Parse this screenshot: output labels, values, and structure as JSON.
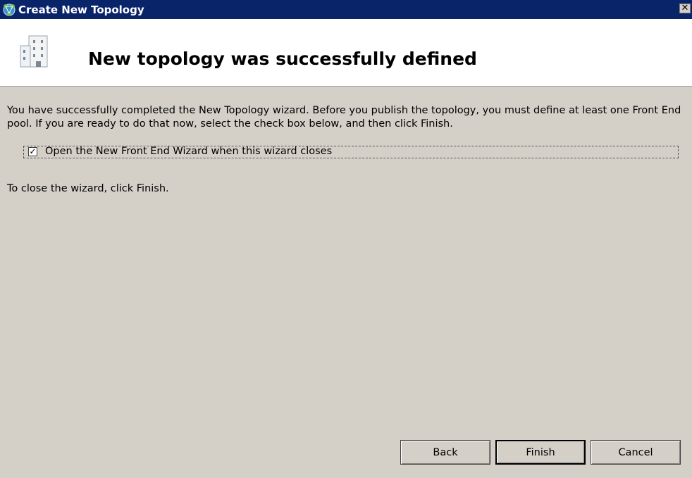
{
  "window": {
    "title": "Create New Topology",
    "close_glyph": "✕",
    "app_icon": "topology-network-icon"
  },
  "header": {
    "icon": "building-icon",
    "title": "New topology was successfully defined"
  },
  "content": {
    "description": "You have successfully completed the New Topology wizard. Before you publish the topology, you must define at least one Front End pool. If you are ready to do that now, select the check box below, and then click Finish.",
    "checkbox": {
      "label": "Open the New Front End Wizard when this wizard closes",
      "checked": true,
      "glyph": "✓"
    },
    "close_hint": "To close the wizard, click Finish."
  },
  "buttons": {
    "back": "Back",
    "finish": "Finish",
    "cancel": "Cancel"
  },
  "colors": {
    "titlebar": "#0a246a",
    "dialog_bg": "#d4d0c8",
    "header_bg": "#ffffff"
  }
}
